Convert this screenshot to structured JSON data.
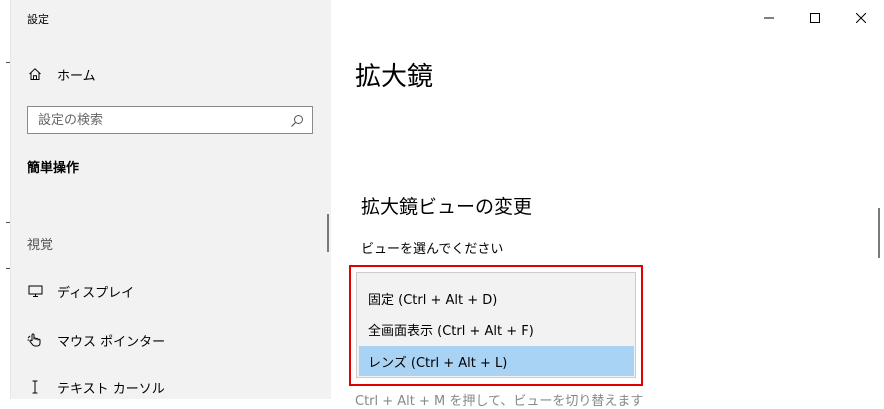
{
  "window": {
    "app_title": "設定",
    "controls": {
      "minimize_icon": "minimize-icon",
      "maximize_icon": "maximize-icon",
      "close_icon": "close-icon"
    }
  },
  "sidebar": {
    "home": {
      "label": "ホーム",
      "icon": "home-icon"
    },
    "search": {
      "placeholder": "設定の検索",
      "icon": "search-icon"
    },
    "section_title": "簡単操作",
    "group_label": "視覚",
    "items": [
      {
        "label": "ディスプレイ",
        "icon": "monitor-icon"
      },
      {
        "label": "マウス ポインター",
        "icon": "pointer-icon"
      },
      {
        "label": "テキスト カーソル",
        "icon": "text-cursor-icon"
      }
    ]
  },
  "main": {
    "page_title": "拡大鏡",
    "section_heading": "拡大鏡ビューの変更",
    "view_label": "ビューを選んでください",
    "view_options": [
      {
        "label": "固定 (Ctrl + Alt + D)",
        "selected": false
      },
      {
        "label": "全画面表示 (Ctrl + Alt + F)",
        "selected": false
      },
      {
        "label": "レンズ (Ctrl + Alt + L)",
        "selected": true
      }
    ],
    "cut_off_text": "Ctrl + Alt + M を押して、ビューを切り替えます"
  },
  "colors": {
    "selection": "#a8d3f5",
    "highlight_border": "#e00000",
    "sidebar_bg": "#f2f2f2"
  }
}
